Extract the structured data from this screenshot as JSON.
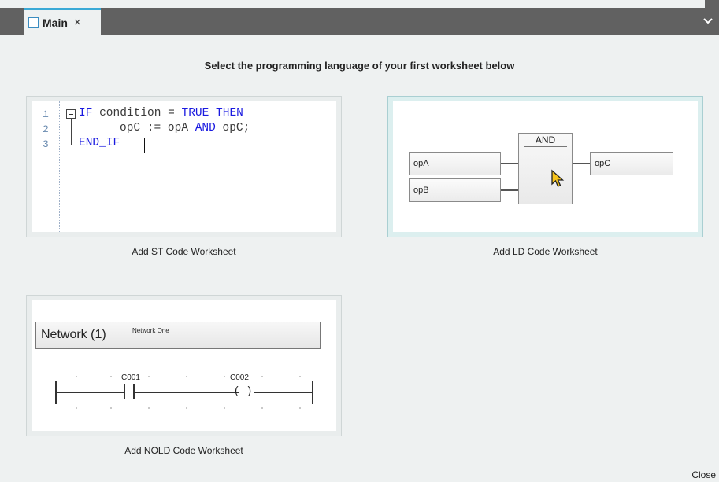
{
  "tabs": [
    {
      "label": "Main",
      "close_glyph": "×",
      "icon": "worksheet-icon"
    }
  ],
  "tabbar": {
    "menu_icon": "chevron-down-icon"
  },
  "instruction": "Select the programming language of your first worksheet below",
  "cards": {
    "st": {
      "label": "Add ST Code Worksheet",
      "line_numbers": [
        "1",
        "2",
        "3"
      ],
      "code": {
        "l1_kw1": "IF",
        "l1_text": " condition = ",
        "l1_kw2": "TRUE THEN",
        "l2_text1": "opC := opA ",
        "l2_kw": "AND",
        "l2_text2": " opC;",
        "l3_kw": "END_IF"
      }
    },
    "ld": {
      "label": "Add LD Code Worksheet",
      "block_title": "AND",
      "inputs": [
        "opA",
        "opB"
      ],
      "output": "opC"
    },
    "nold": {
      "label": "Add NOLD Code Worksheet",
      "network_title": "Network (1)",
      "network_comment": "Network One",
      "contact": "C001",
      "coil": "C002",
      "coil_glyph": "( )"
    }
  },
  "footer": {
    "close_label": "Close"
  },
  "colors": {
    "tab_accent": "#39a9d6",
    "tabbar_bg": "#616161",
    "keyword_blue": "#1a1ae0"
  }
}
